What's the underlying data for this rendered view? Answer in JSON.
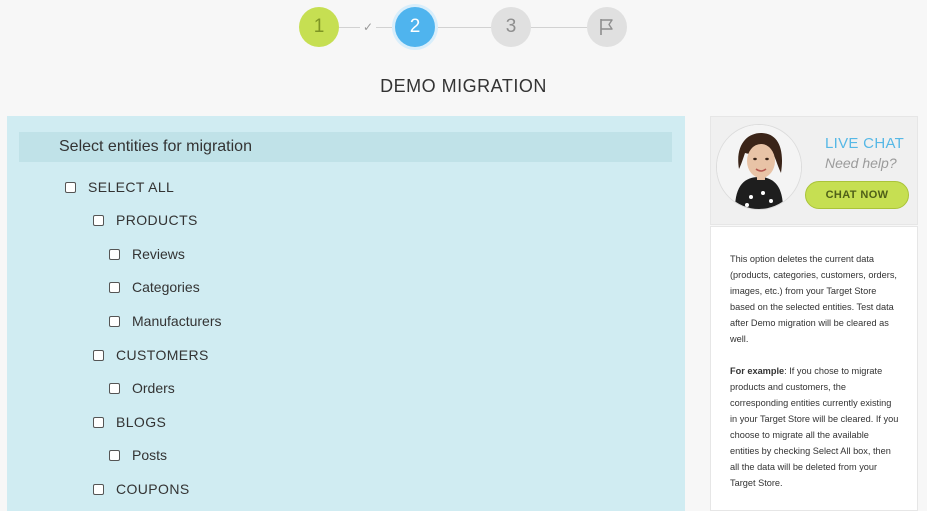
{
  "stepper": {
    "steps": [
      {
        "label": "1",
        "state": "done"
      },
      {
        "label": "2",
        "state": "active"
      },
      {
        "label": "3",
        "state": "pending"
      },
      {
        "icon": "flag-icon",
        "state": "pending"
      }
    ],
    "check_icon": "✓"
  },
  "page_title": "DEMO MIGRATION",
  "entities": {
    "header": "Select entities for migration",
    "select_all": "SELECT ALL",
    "items": [
      {
        "label": "PRODUCTS",
        "level": 1
      },
      {
        "label": "Reviews",
        "level": 2
      },
      {
        "label": "Categories",
        "level": 2
      },
      {
        "label": "Manufacturers",
        "level": 2
      },
      {
        "label": "CUSTOMERS",
        "level": 1
      },
      {
        "label": "Orders",
        "level": 2
      },
      {
        "label": "BLOGS",
        "level": 1
      },
      {
        "label": "Posts",
        "level": 2
      },
      {
        "label": "COUPONS",
        "level": 1
      }
    ]
  },
  "chat": {
    "title": "LIVE CHAT",
    "subtitle": "Need help?",
    "button": "CHAT NOW"
  },
  "info": {
    "paragraph1": "This option deletes the current data (products, categories, customers, orders, images, etc.) from your Target Store based on the selected entities. Test data after Demo migration will be cleared as well.",
    "example_label": "For example",
    "paragraph2": ": If you chose to migrate products and customers, the corresponding entities currently existing in your Target Store will be cleared. If you choose to migrate all the available entities by checking Select All box, then all the data will be deleted from your Target Store."
  },
  "colors": {
    "done": "#c6df52",
    "active": "#4fb4ee",
    "pending": "#e0e0e0",
    "panel": "#d0ecf2",
    "accent": "#56b8e6"
  }
}
